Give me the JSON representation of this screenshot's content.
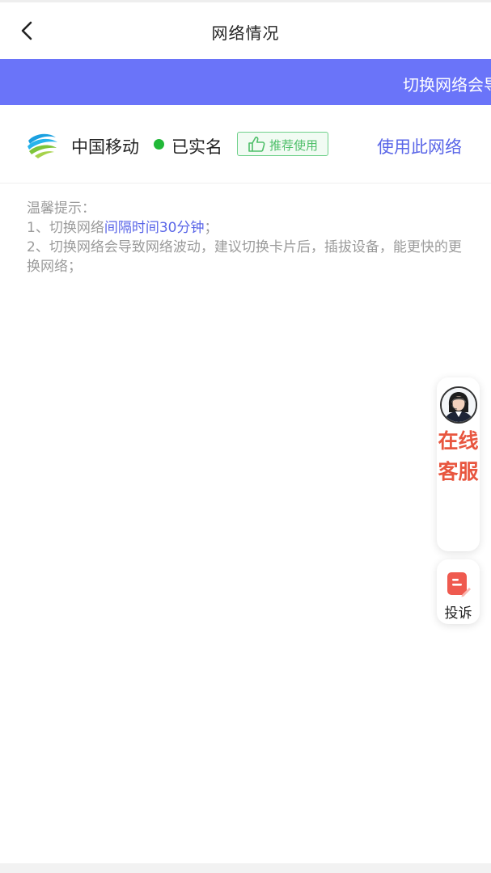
{
  "header": {
    "title": "网络情况",
    "back_icon": "chevron-left-icon"
  },
  "banner": {
    "text": "切换网络会导致网络波动，建议切换卡片后，插拔设备，能更快的更换网络",
    "color": "#6a74f9"
  },
  "network": {
    "operator": "中国移动",
    "operator_logo": "china-mobile-logo",
    "status_text": "已实名",
    "status_color": "#21b838",
    "recommend_tag": "推荐使用",
    "recommend_icon": "thumbs-up-icon",
    "use_button": "使用此网络"
  },
  "tips": {
    "title": "温馨提示：",
    "line1_prefix": "1、切换网络",
    "line1_highlight": "间隔时间30分钟",
    "line1_suffix": "；",
    "line2": "2、切换网络会导致网络波动，建议切换卡片后，插拔设备，能更快的更换网络；"
  },
  "float_service": {
    "label": "在线客服",
    "avatar_icon": "agent-avatar-icon",
    "color": "#e8563f"
  },
  "float_complaint": {
    "label": "投诉",
    "icon": "complaint-note-icon",
    "color": "#e8563f"
  }
}
